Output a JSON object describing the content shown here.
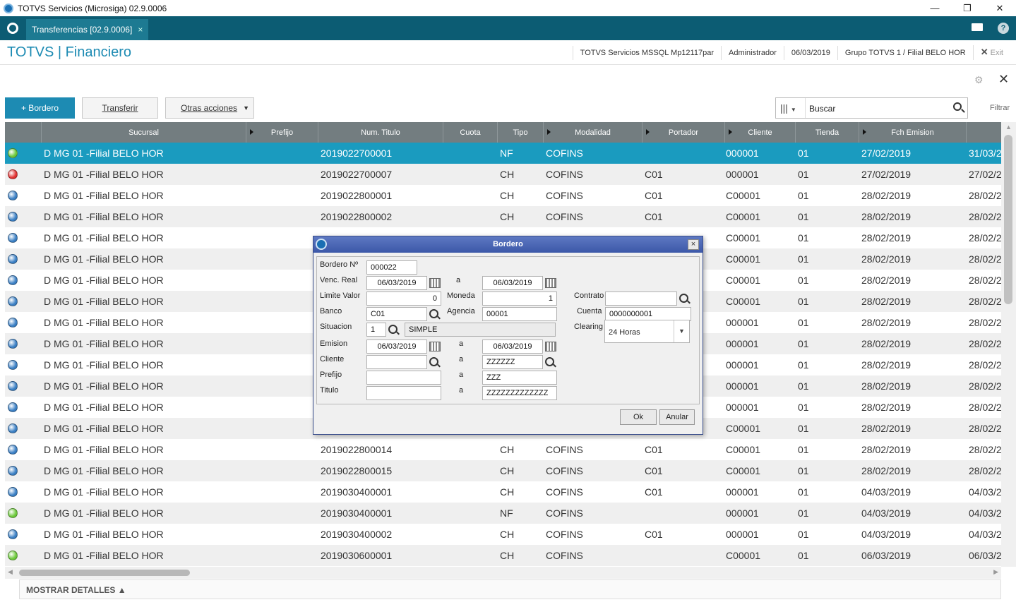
{
  "window": {
    "title": "TOTVS Servicios (Microsiga) 02.9.0006",
    "minimize": "—",
    "maximize": "❐",
    "close": "✕"
  },
  "tabbar": {
    "tab_label": "Transferencias [02.9.0006]",
    "tab_close": "×"
  },
  "header": {
    "brand": "TOTVS | Financiero",
    "server": "TOTVS Servicios MSSQL Mp12117par",
    "user": "Administrador",
    "date": "06/03/2019",
    "group": "Grupo TOTVS 1 / Filial BELO HOR",
    "exit": "Exit"
  },
  "toolbar": {
    "bordero_label": "+ Bordero",
    "transferir_label": "Transferir",
    "otras_label": "Otras acciones",
    "search_value": "Buscar",
    "filtrar_label": "Filtrar"
  },
  "grid": {
    "columns": [
      "Sucursal",
      "Prefijo",
      "Num. Titulo",
      "Cuota",
      "Tipo",
      "Modalidad",
      "Portador",
      "Cliente",
      "Tienda",
      "Fch Emision"
    ],
    "rows": [
      {
        "status": "green",
        "sucursal": "D MG 01 -Filial BELO HOR",
        "num": "2019022700001",
        "tipo": "NF",
        "modalidad": "COFINS",
        "portador": "",
        "cliente": "000001",
        "tienda": "01",
        "emision": "27/02/2019",
        "extra": "31/03/2"
      },
      {
        "status": "red",
        "sucursal": "D MG 01 -Filial BELO HOR",
        "num": "2019022700007",
        "tipo": "CH",
        "modalidad": "COFINS",
        "portador": "C01",
        "cliente": "000001",
        "tienda": "01",
        "emision": "27/02/2019",
        "extra": "27/02/2"
      },
      {
        "status": "blue",
        "sucursal": "D MG 01 -Filial BELO HOR",
        "num": "2019022800001",
        "tipo": "CH",
        "modalidad": "COFINS",
        "portador": "C01",
        "cliente": "C00001",
        "tienda": "01",
        "emision": "28/02/2019",
        "extra": "28/02/2"
      },
      {
        "status": "blue",
        "sucursal": "D MG 01 -Filial BELO HOR",
        "num": "2019022800002",
        "tipo": "CH",
        "modalidad": "COFINS",
        "portador": "C01",
        "cliente": "C00001",
        "tienda": "01",
        "emision": "28/02/2019",
        "extra": "28/02/2"
      },
      {
        "status": "blue",
        "sucursal": "D MG 01 -Filial BELO HOR",
        "num": "",
        "tipo": "",
        "modalidad": "",
        "portador": "",
        "cliente": "C00001",
        "tienda": "01",
        "emision": "28/02/2019",
        "extra": "28/02/2"
      },
      {
        "status": "blue",
        "sucursal": "D MG 01 -Filial BELO HOR",
        "num": "",
        "tipo": "",
        "modalidad": "",
        "portador": "",
        "cliente": "C00001",
        "tienda": "01",
        "emision": "28/02/2019",
        "extra": "28/02/2"
      },
      {
        "status": "blue",
        "sucursal": "D MG 01 -Filial BELO HOR",
        "num": "",
        "tipo": "",
        "modalidad": "",
        "portador": "",
        "cliente": "C00001",
        "tienda": "01",
        "emision": "28/02/2019",
        "extra": "28/02/2"
      },
      {
        "status": "blue",
        "sucursal": "D MG 01 -Filial BELO HOR",
        "num": "",
        "tipo": "",
        "modalidad": "",
        "portador": "",
        "cliente": "C00001",
        "tienda": "01",
        "emision": "28/02/2019",
        "extra": "28/02/2"
      },
      {
        "status": "blue",
        "sucursal": "D MG 01 -Filial BELO HOR",
        "num": "",
        "tipo": "",
        "modalidad": "",
        "portador": "",
        "cliente": "000001",
        "tienda": "01",
        "emision": "28/02/2019",
        "extra": "28/02/2"
      },
      {
        "status": "blue",
        "sucursal": "D MG 01 -Filial BELO HOR",
        "num": "",
        "tipo": "",
        "modalidad": "",
        "portador": "",
        "cliente": "000001",
        "tienda": "01",
        "emision": "28/02/2019",
        "extra": "28/02/2"
      },
      {
        "status": "blue",
        "sucursal": "D MG 01 -Filial BELO HOR",
        "num": "",
        "tipo": "",
        "modalidad": "",
        "portador": "",
        "cliente": "000001",
        "tienda": "01",
        "emision": "28/02/2019",
        "extra": "28/02/2"
      },
      {
        "status": "blue",
        "sucursal": "D MG 01 -Filial BELO HOR",
        "num": "",
        "tipo": "",
        "modalidad": "",
        "portador": "",
        "cliente": "000001",
        "tienda": "01",
        "emision": "28/02/2019",
        "extra": "28/02/2"
      },
      {
        "status": "blue",
        "sucursal": "D MG 01 -Filial BELO HOR",
        "num": "",
        "tipo": "",
        "modalidad": "",
        "portador": "",
        "cliente": "000001",
        "tienda": "01",
        "emision": "28/02/2019",
        "extra": "28/02/2"
      },
      {
        "status": "blue",
        "sucursal": "D MG 01 -Filial BELO HOR",
        "num": "",
        "tipo": "",
        "modalidad": "",
        "portador": "",
        "cliente": "C00001",
        "tienda": "01",
        "emision": "28/02/2019",
        "extra": "28/02/2"
      },
      {
        "status": "blue",
        "sucursal": "D MG 01 -Filial BELO HOR",
        "num": "2019022800014",
        "tipo": "CH",
        "modalidad": "COFINS",
        "portador": "C01",
        "cliente": "C00001",
        "tienda": "01",
        "emision": "28/02/2019",
        "extra": "28/02/2"
      },
      {
        "status": "blue",
        "sucursal": "D MG 01 -Filial BELO HOR",
        "num": "2019022800015",
        "tipo": "CH",
        "modalidad": "COFINS",
        "portador": "C01",
        "cliente": "C00001",
        "tienda": "01",
        "emision": "28/02/2019",
        "extra": "28/02/2"
      },
      {
        "status": "blue",
        "sucursal": "D MG 01 -Filial BELO HOR",
        "num": "2019030400001",
        "tipo": "CH",
        "modalidad": "COFINS",
        "portador": "C01",
        "cliente": "000001",
        "tienda": "01",
        "emision": "04/03/2019",
        "extra": "04/03/2"
      },
      {
        "status": "green",
        "sucursal": "D MG 01 -Filial BELO HOR",
        "num": "2019030400001",
        "tipo": "NF",
        "modalidad": "COFINS",
        "portador": "",
        "cliente": "000001",
        "tienda": "01",
        "emision": "04/03/2019",
        "extra": "04/03/2"
      },
      {
        "status": "blue",
        "sucursal": "D MG 01 -Filial BELO HOR",
        "num": "2019030400002",
        "tipo": "CH",
        "modalidad": "COFINS",
        "portador": "C01",
        "cliente": "000001",
        "tienda": "01",
        "emision": "04/03/2019",
        "extra": "04/03/2"
      },
      {
        "status": "green",
        "sucursal": "D MG 01 -Filial BELO HOR",
        "num": "2019030600001",
        "tipo": "CH",
        "modalidad": "COFINS",
        "portador": "",
        "cliente": "C00001",
        "tienda": "01",
        "emision": "06/03/2019",
        "extra": "06/03/2"
      }
    ],
    "status_colors": {
      "green": "#6cc93a",
      "red": "#e03030",
      "blue": "#3a7fc4"
    }
  },
  "footer": {
    "label": "MOSTRAR DETALLES ▲"
  },
  "dialog": {
    "title": "Bordero",
    "close": "×",
    "bordero_label": "Bordero Nº",
    "bordero_value": "000022",
    "venc_label": "Venc. Real",
    "venc_from": "06/03/2019",
    "venc_to": "06/03/2019",
    "a": "a",
    "limite_label": "Limite Valor",
    "limite_value": "0",
    "moneda_label": "Moneda",
    "moneda_value": "1",
    "contrato_label": "Contrato",
    "contrato_value": "",
    "banco_label": "Banco",
    "banco_value": "C01",
    "agencia_label": "Agencia",
    "agencia_value": "00001",
    "cuenta_label": "Cuenta",
    "cuenta_value": "0000000001",
    "situacion_label": "Situacion",
    "situacion_code": "1",
    "situacion_desc": "SIMPLE",
    "clearing_label": "Clearing",
    "clearing_value": "24 Horas",
    "emision_label": "Emision",
    "emision_from": "06/03/2019",
    "emision_to": "06/03/2019",
    "cliente_label": "Cliente",
    "cliente_from": "",
    "cliente_to": "ZZZZZZ",
    "prefijo_label": "Prefijo",
    "prefijo_from": "",
    "prefijo_to": "ZZZ",
    "titulo_label": "Titulo",
    "titulo_from": "",
    "titulo_to": "ZZZZZZZZZZZZZ",
    "ok_label": "Ok",
    "anular_label": "Anular"
  }
}
